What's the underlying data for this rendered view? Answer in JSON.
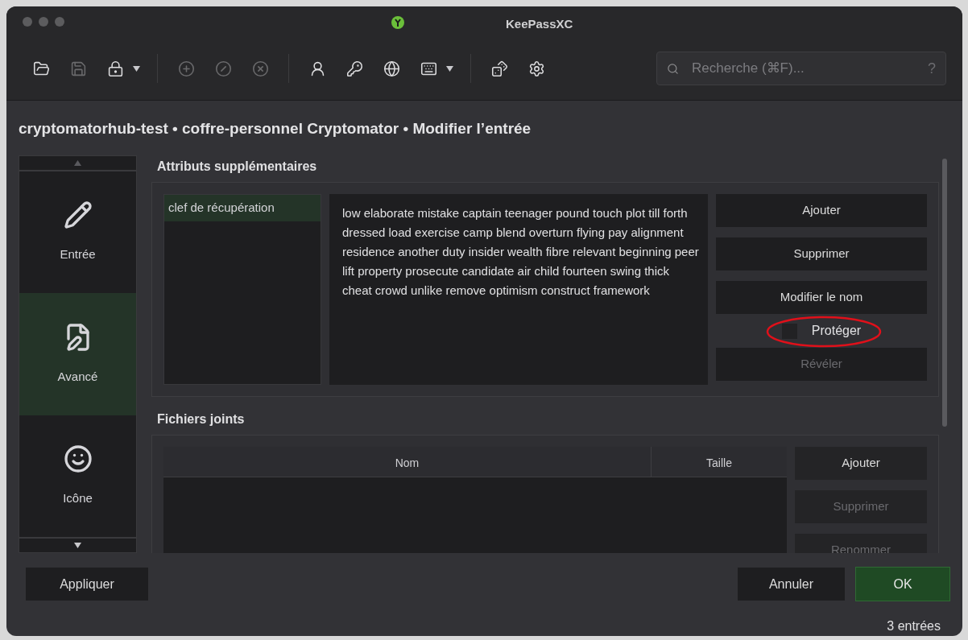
{
  "window": {
    "title": "KeePassXC"
  },
  "toolbar": [
    {
      "kind": "icon",
      "disabled": false,
      "dropdown": false
    },
    {
      "kind": "icon",
      "disabled": true,
      "dropdown": false
    },
    {
      "kind": "icon",
      "disabled": false,
      "dropdown": true
    },
    {
      "kind": "separator"
    },
    {
      "kind": "icon",
      "disabled": true,
      "dropdown": false
    },
    {
      "kind": "icon",
      "disabled": true,
      "dropdown": false
    },
    {
      "kind": "icon",
      "disabled": true,
      "dropdown": false
    },
    {
      "kind": "separator"
    },
    {
      "kind": "icon",
      "disabled": false,
      "dropdown": false
    },
    {
      "kind": "icon",
      "disabled": false,
      "dropdown": false
    },
    {
      "kind": "icon",
      "disabled": false,
      "dropdown": false
    },
    {
      "kind": "icon",
      "disabled": false,
      "dropdown": true
    },
    {
      "kind": "separator"
    },
    {
      "kind": "icon",
      "disabled": false,
      "dropdown": false
    },
    {
      "kind": "icon",
      "disabled": false,
      "dropdown": false
    }
  ],
  "search": {
    "placeholder": "Recherche (⌘F)...",
    "help": "?"
  },
  "breadcrumb": "cryptomatorhub-test • coffre-personnel Cryptomator • Modifier l’entrée",
  "sidebar": {
    "items": [
      {
        "label": "Entrée",
        "selected": false
      },
      {
        "label": "Avancé",
        "selected": true
      },
      {
        "label": "Icône",
        "selected": false
      }
    ]
  },
  "attributes": {
    "title": "Attributs supplémentaires",
    "items": [
      {
        "label": "clef de récupération",
        "selected": true
      }
    ],
    "value": "low elaborate mistake captain teenager pound touch plot till forth dressed load exercise camp blend overturn flying pay alignment residence another duty insider wealth fibre relevant beginning peer lift property prosecute candidate air child fourteen swing thick cheat crowd unlike remove optimism construct framework",
    "buttons": [
      {
        "label": "Ajouter",
        "disabled": false
      },
      {
        "label": "Supprimer",
        "disabled": false
      },
      {
        "label": "Modifier le nom",
        "disabled": false
      }
    ],
    "protect": {
      "label": "Protéger",
      "checked": false,
      "highlighted": true
    },
    "reveal": {
      "label": "Révéler",
      "disabled": true
    }
  },
  "attachments": {
    "title": "Fichiers joints",
    "columns": [
      "Nom",
      "Taille"
    ],
    "buttons": [
      {
        "label": "Ajouter",
        "disabled": false
      },
      {
        "label": "Supprimer",
        "disabled": true
      },
      {
        "label": "Renommer",
        "disabled": true
      }
    ]
  },
  "footer": {
    "apply": "Appliquer",
    "cancel": "Annuler",
    "ok": "OK"
  },
  "status_bar": "3 entrées"
}
